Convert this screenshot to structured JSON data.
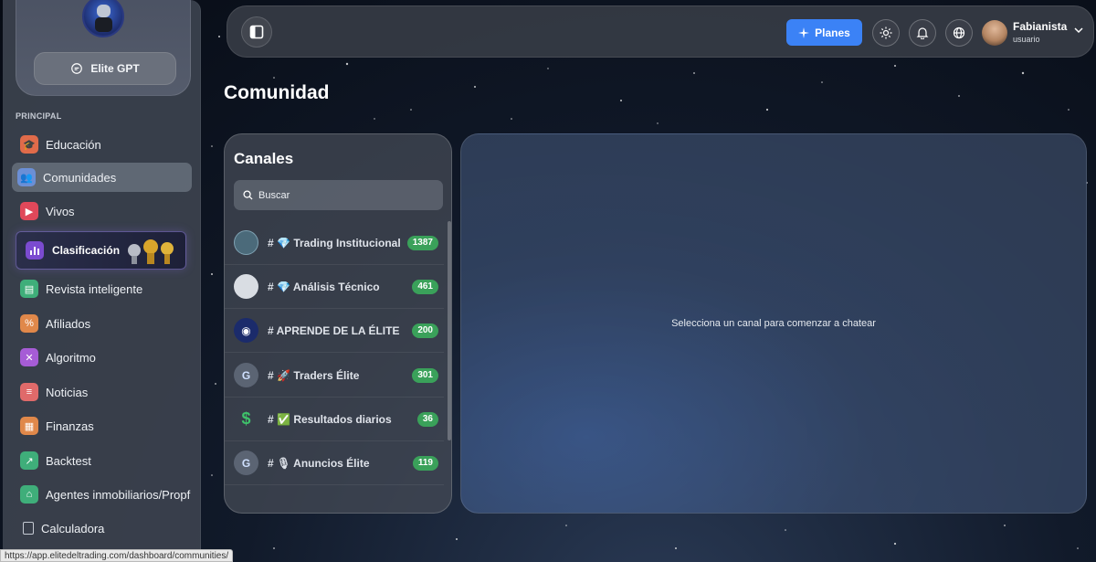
{
  "sidebar": {
    "gpt_button_label": "Elite GPT",
    "section_label": "PRINCIPAL",
    "items": [
      {
        "label": "Educación",
        "icon": "graduation-cap-icon",
        "color": "#e06b4a"
      },
      {
        "label": "Comunidades",
        "icon": "community-icon",
        "color": "#6b8fd6"
      },
      {
        "label": "Vivos",
        "icon": "live-video-icon",
        "color": "#e0485a"
      },
      {
        "label": "Clasificación",
        "icon": "bar-chart-icon",
        "color": "#7b4bd0"
      },
      {
        "label": "Revista inteligente",
        "icon": "magazine-icon",
        "color": "#3fae7a"
      },
      {
        "label": "Afiliados",
        "icon": "affiliates-icon",
        "color": "#e0884a"
      },
      {
        "label": "Algoritmo",
        "icon": "algorithm-icon",
        "color": "#a65cd6"
      },
      {
        "label": "Noticias",
        "icon": "news-icon",
        "color": "#e06a6a"
      },
      {
        "label": "Finanzas",
        "icon": "finance-icon",
        "color": "#e0884a"
      },
      {
        "label": "Backtest",
        "icon": "backtest-icon",
        "color": "#3fae7a"
      },
      {
        "label": "Agentes inmobiliarios/Propf",
        "icon": "agents-icon",
        "color": "#3fae7a"
      },
      {
        "label": "Calculadora",
        "icon": "calculator-icon",
        "color": "#9aa0aa"
      }
    ],
    "active_item": "Comunidades"
  },
  "topbar": {
    "planes_label": "Planes",
    "user_name": "Fabianista",
    "user_role": "usuario"
  },
  "main": {
    "title": "Comunidad",
    "channels_title": "Canales",
    "search_placeholder": "Buscar",
    "channels": [
      {
        "prefix": "#",
        "emoji": "💎",
        "name": "Trading Institucional",
        "count": "1387"
      },
      {
        "prefix": "#",
        "emoji": "💎",
        "name": "Análisis Técnico",
        "count": "461"
      },
      {
        "prefix": "#",
        "emoji": "",
        "name": "APRENDE DE LA ÉLITE",
        "count": "200"
      },
      {
        "prefix": "#",
        "emoji": "🚀",
        "name": "Traders Élite",
        "count": "301"
      },
      {
        "prefix": "#",
        "emoji": "✅",
        "name": "Resultados diarios",
        "count": "36"
      },
      {
        "prefix": "#",
        "emoji": "🎙",
        "name": "Anuncios Élite",
        "count": "119"
      }
    ],
    "chat_empty_text": "Selecciona un canal para comenzar a chatear"
  },
  "status_bar": {
    "url": "https://app.elitedeltrading.com/dashboard/communities/"
  }
}
